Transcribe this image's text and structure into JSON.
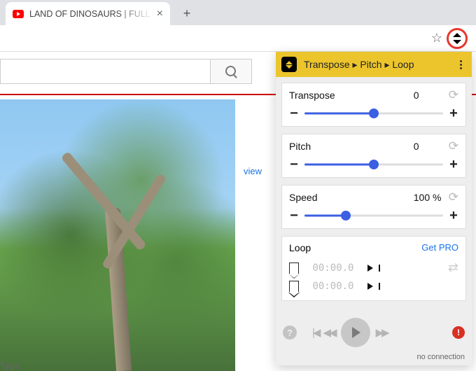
{
  "browser": {
    "tab_title": "LAND OF DINOSAURS | FULL M",
    "new_tab_label": "+",
    "tab_close": "×"
  },
  "page": {
    "view_link_fragment": "view",
    "type_fragment": "Type"
  },
  "extension": {
    "title": "Transpose ▸ Pitch ▸ Loop",
    "controls": {
      "transpose": {
        "label": "Transpose",
        "value": "0"
      },
      "pitch": {
        "label": "Pitch",
        "value": "0"
      },
      "speed": {
        "label": "Speed",
        "value": "100 %"
      }
    },
    "loop": {
      "label": "Loop",
      "pro_link": "Get PRO",
      "start_time": "00:00.0",
      "end_time": "00:00.0"
    },
    "status": {
      "connection": "no connection"
    }
  }
}
